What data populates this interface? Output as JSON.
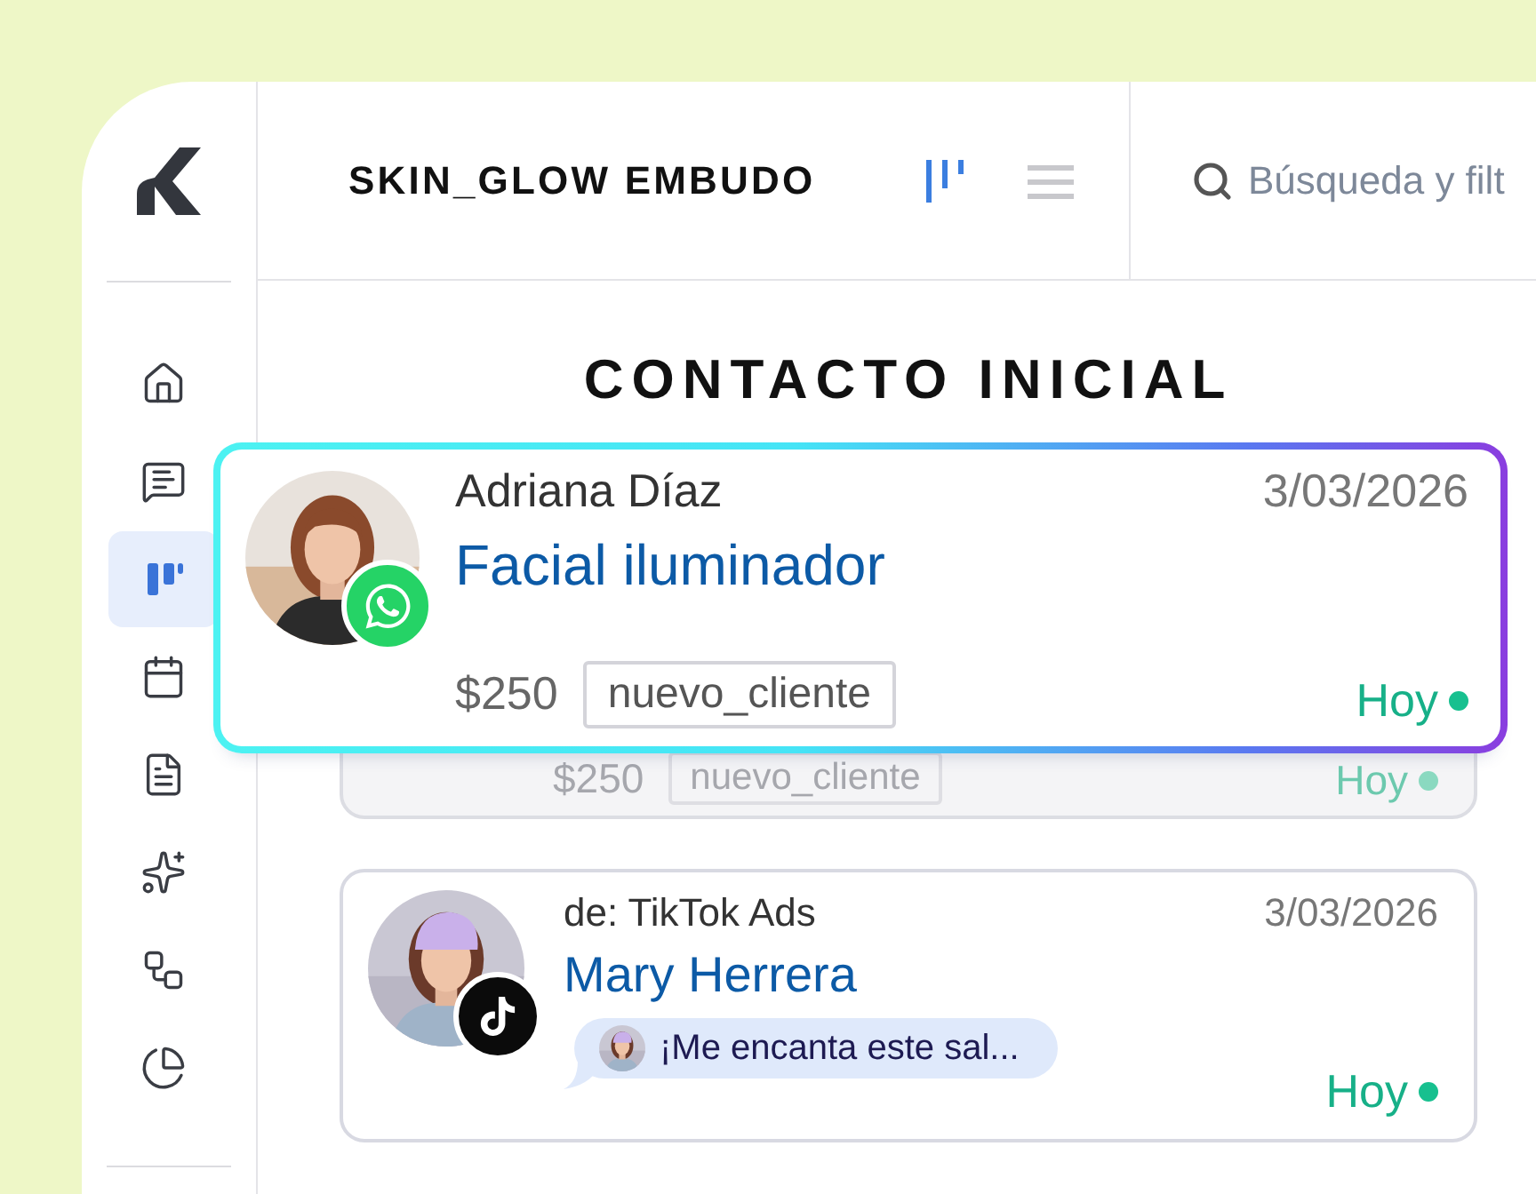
{
  "header": {
    "board_title": "SKIN_GLOW EMBUDO",
    "views": [
      {
        "kind": "kanban",
        "selected": true
      },
      {
        "kind": "list",
        "selected": false
      }
    ],
    "search": {
      "placeholder": "Búsqueda y filt"
    }
  },
  "sidebar": {
    "items": [
      {
        "kind": "home",
        "selected": false
      },
      {
        "kind": "chat",
        "selected": false
      },
      {
        "kind": "kanban",
        "selected": true
      },
      {
        "kind": "calendar",
        "selected": false
      },
      {
        "kind": "document",
        "selected": false
      },
      {
        "kind": "sparkles",
        "selected": false
      },
      {
        "kind": "workflow",
        "selected": false
      },
      {
        "kind": "chart",
        "selected": false
      }
    ]
  },
  "column": {
    "title": "CONTACTO INICIAL",
    "cards": [
      {
        "kind": "placeholder",
        "amount": "$250",
        "tag": "nuevo_cliente",
        "due": "Hoy"
      },
      {
        "kind": "message",
        "source": "de: TikTok Ads",
        "date": "3/03/2026",
        "name": "Mary Herrera",
        "badge": {
          "kind": "tiktok"
        },
        "message": "¡Me encanta este sal...",
        "due": "Hoy"
      }
    ],
    "dragging_card": {
      "name": "Adriana Díaz",
      "date": "3/03/2026",
      "title": "Facial iluminador",
      "badge": {
        "kind": "whatsapp"
      },
      "amount": "$250",
      "tag": "nuevo_cliente",
      "due": "Hoy"
    }
  }
}
